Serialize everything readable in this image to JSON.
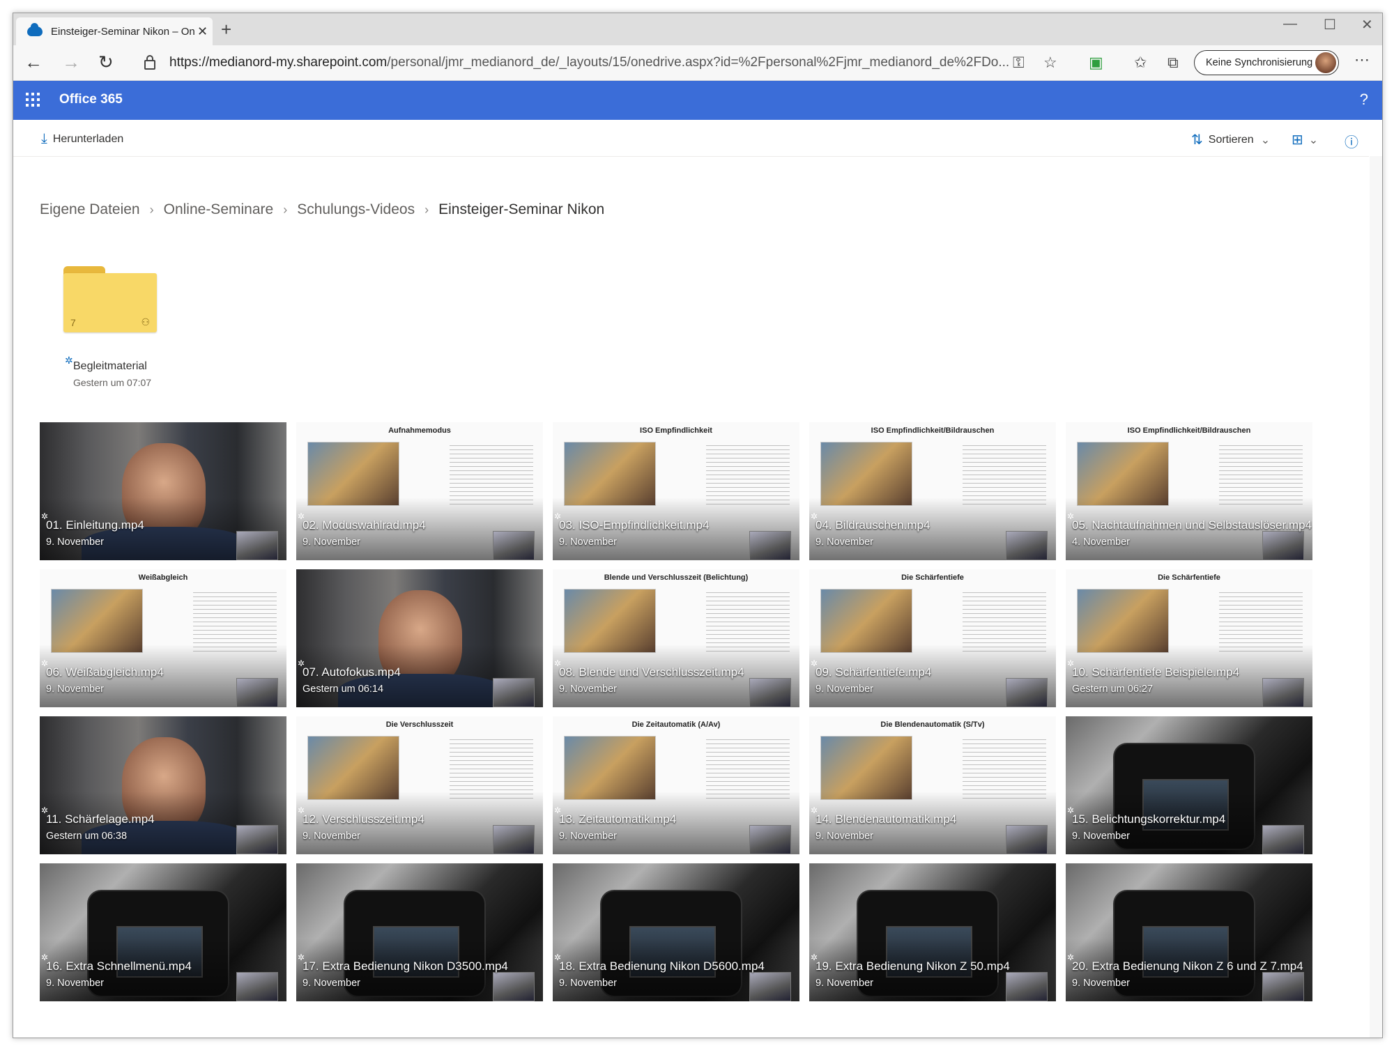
{
  "browser": {
    "tab_title": "Einsteiger-Seminar Nikon – OneDrive",
    "url_main": "https://medianord-my.sharepoint.com",
    "url_rest": "/personal/jmr_medianord_de/_layouts/15/onedrive.aspx?id=%2Fpersonal%2Fjmr_medianord_de%2FDo...",
    "sync_label": "Keine Synchronisierung"
  },
  "suite": {
    "brand": "Office 365",
    "help": "?"
  },
  "commands": {
    "download": "Herunterladen",
    "sort": "Sortieren"
  },
  "breadcrumb": {
    "items": [
      "Eigene Dateien",
      "Online-Seminare",
      "Schulungs-Videos"
    ],
    "current": "Einsteiger-Seminar Nikon"
  },
  "folder": {
    "name": "Begleitmaterial",
    "date": "Gestern um 07:07",
    "count": "7"
  },
  "files": [
    {
      "name": "01. Einleitung.mp4",
      "date": "9. November",
      "kind": "person"
    },
    {
      "name": "02. Moduswahlrad.mp4",
      "date": "9. November",
      "kind": "slide",
      "heading": "Aufnahmemodus"
    },
    {
      "name": "03. ISO-Empfindlichkeit.mp4",
      "date": "9. November",
      "kind": "slide",
      "heading": "ISO Empfindlichkeit"
    },
    {
      "name": "04. Bildrauschen.mp4",
      "date": "9. November",
      "kind": "slide",
      "heading": "ISO Empfindlichkeit/Bildrauschen"
    },
    {
      "name": "05. Nachtaufnahmen und Selbstauslöser.mp4",
      "date": "4. November",
      "kind": "slide",
      "heading": "ISO Empfindlichkeit/Bildrauschen"
    },
    {
      "name": "06. Weißabgleich.mp4",
      "date": "9. November",
      "kind": "slide",
      "heading": "Weißabgleich"
    },
    {
      "name": "07. Autofokus.mp4",
      "date": "Gestern um 06:14",
      "kind": "person"
    },
    {
      "name": "08. Blende und Verschlusszeit.mp4",
      "date": "9. November",
      "kind": "slide",
      "heading": "Blende und Verschlusszeit (Belichtung)"
    },
    {
      "name": "09. Schärfentiefe.mp4",
      "date": "9. November",
      "kind": "slide",
      "heading": "Die Schärfentiefe"
    },
    {
      "name": "10. Schärfentiefe Beispiele.mp4",
      "date": "Gestern um 06:27",
      "kind": "slide",
      "heading": "Die Schärfentiefe"
    },
    {
      "name": "11. Schärfelage.mp4",
      "date": "Gestern um 06:38",
      "kind": "person"
    },
    {
      "name": "12. Verschlusszeit.mp4",
      "date": "9. November",
      "kind": "slide",
      "heading": "Die Verschlusszeit"
    },
    {
      "name": "13. Zeitautomatik.mp4",
      "date": "9. November",
      "kind": "slide",
      "heading": "Die Zeitautomatik (A/Av)"
    },
    {
      "name": "14. Blendenautomatik.mp4",
      "date": "9. November",
      "kind": "slide",
      "heading": "Die Blendenautomatik (S/Tv)"
    },
    {
      "name": "15. Belichtungskorrektur.mp4",
      "date": "9. November",
      "kind": "camera"
    },
    {
      "name": "16. Extra Schnellmenü.mp4",
      "date": "9. November",
      "kind": "camera"
    },
    {
      "name": "17. Extra Bedienung Nikon D3500.mp4",
      "date": "9. November",
      "kind": "camera"
    },
    {
      "name": "18. Extra Bedienung Nikon D5600.mp4",
      "date": "9. November",
      "kind": "camera"
    },
    {
      "name": "19. Extra Bedienung Nikon Z 50.mp4",
      "date": "9. November",
      "kind": "camera"
    },
    {
      "name": "20. Extra Bedienung Nikon Z 6 und Z 7.mp4",
      "date": "9. November",
      "kind": "camera"
    }
  ]
}
